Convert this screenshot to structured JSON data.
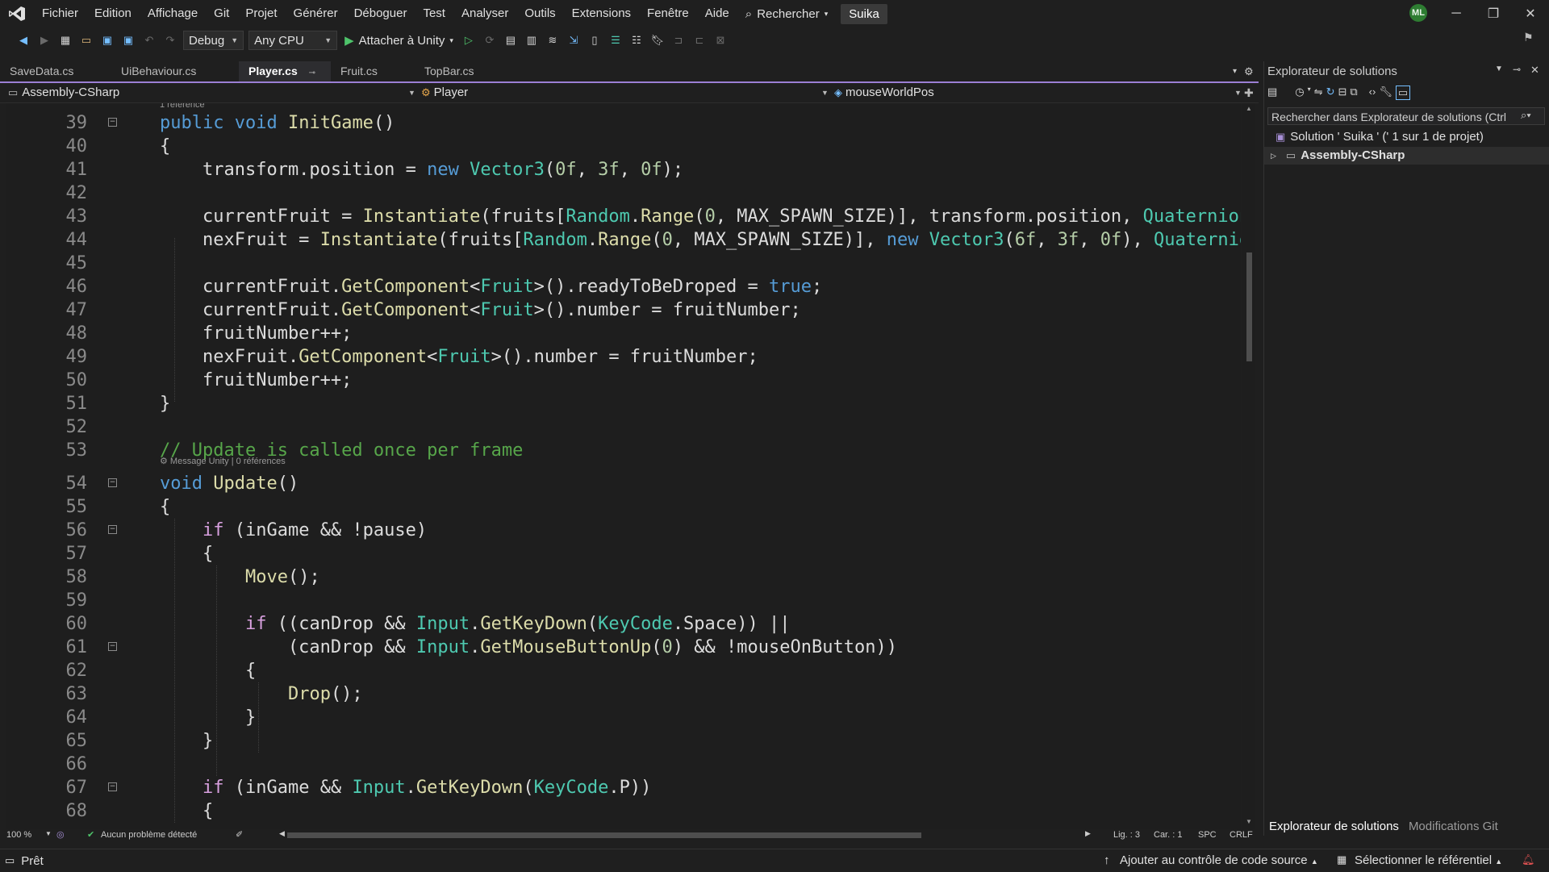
{
  "menu": [
    "Fichier",
    "Edition",
    "Affichage",
    "Git",
    "Projet",
    "Générer",
    "Déboguer",
    "Test",
    "Analyser",
    "Outils",
    "Extensions",
    "Fenêtre",
    "Aide"
  ],
  "search_label": "Rechercher",
  "solution_name": "Suika",
  "user_initials": "ML",
  "toolbar": {
    "config": "Debug",
    "platform": "Any CPU",
    "attach_label": "Attacher à Unity"
  },
  "tabs": [
    {
      "label": "SaveData.cs",
      "active": false
    },
    {
      "label": "UiBehaviour.cs",
      "active": false
    },
    {
      "label": "Player.cs",
      "active": true
    },
    {
      "label": "Fruit.cs",
      "active": false
    },
    {
      "label": "TopBar.cs",
      "active": false
    }
  ],
  "nav": {
    "project": "Assembly-CSharp",
    "type": "Player",
    "member": "mouseWorldPos"
  },
  "codelens": {
    "top": "1 référence",
    "update": "Message Unity | 0 références"
  },
  "code": [
    {
      "n": "39",
      "fold": true,
      "tokens": [
        [
          "kw",
          "public"
        ],
        [
          "pl",
          " "
        ],
        [
          "kw",
          "void"
        ],
        [
          "pl",
          " "
        ],
        [
          "fn",
          "InitGame"
        ],
        [
          "pl",
          "()"
        ]
      ]
    },
    {
      "n": "40",
      "tokens": [
        [
          "pl",
          "{"
        ]
      ]
    },
    {
      "n": "41",
      "tokens": [
        [
          "pl",
          "    transform.position = "
        ],
        [
          "kw",
          "new"
        ],
        [
          "pl",
          " "
        ],
        [
          "ty",
          "Vector3"
        ],
        [
          "pl",
          "("
        ],
        [
          "num",
          "0f"
        ],
        [
          "pl",
          ", "
        ],
        [
          "num",
          "3f"
        ],
        [
          "pl",
          ", "
        ],
        [
          "num",
          "0f"
        ],
        [
          "pl",
          ");"
        ]
      ]
    },
    {
      "n": "42",
      "tokens": []
    },
    {
      "n": "43",
      "tokens": [
        [
          "pl",
          "    currentFruit = "
        ],
        [
          "fn",
          "Instantiate"
        ],
        [
          "pl",
          "(fruits["
        ],
        [
          "ty",
          "Random"
        ],
        [
          "pl",
          "."
        ],
        [
          "fn",
          "Range"
        ],
        [
          "pl",
          "("
        ],
        [
          "num",
          "0"
        ],
        [
          "pl",
          ", MAX_SPAWN_SIZE)], transform.position, "
        ],
        [
          "ty",
          "Quaternion"
        ],
        [
          "pl",
          ".i"
        ]
      ]
    },
    {
      "n": "44",
      "tokens": [
        [
          "pl",
          "    nexFruit = "
        ],
        [
          "fn",
          "Instantiate"
        ],
        [
          "pl",
          "(fruits["
        ],
        [
          "ty",
          "Random"
        ],
        [
          "pl",
          "."
        ],
        [
          "fn",
          "Range"
        ],
        [
          "pl",
          "("
        ],
        [
          "num",
          "0"
        ],
        [
          "pl",
          ", MAX_SPAWN_SIZE)], "
        ],
        [
          "kw",
          "new"
        ],
        [
          "pl",
          " "
        ],
        [
          "ty",
          "Vector3"
        ],
        [
          "pl",
          "("
        ],
        [
          "num",
          "6f"
        ],
        [
          "pl",
          ", "
        ],
        [
          "num",
          "3f"
        ],
        [
          "pl",
          ", "
        ],
        [
          "num",
          "0f"
        ],
        [
          "pl",
          "), "
        ],
        [
          "ty",
          "Quaternion"
        ]
      ]
    },
    {
      "n": "45",
      "tokens": []
    },
    {
      "n": "46",
      "tokens": [
        [
          "pl",
          "    currentFruit."
        ],
        [
          "fn",
          "GetComponent"
        ],
        [
          "pl",
          "<"
        ],
        [
          "ty",
          "Fruit"
        ],
        [
          "pl",
          ">().readyToBeDroped = "
        ],
        [
          "kw",
          "true"
        ],
        [
          "pl",
          ";"
        ]
      ]
    },
    {
      "n": "47",
      "tokens": [
        [
          "pl",
          "    currentFruit."
        ],
        [
          "fn",
          "GetComponent"
        ],
        [
          "pl",
          "<"
        ],
        [
          "ty",
          "Fruit"
        ],
        [
          "pl",
          ">().number = fruitNumber;"
        ]
      ]
    },
    {
      "n": "48",
      "tokens": [
        [
          "pl",
          "    fruitNumber++;"
        ]
      ]
    },
    {
      "n": "49",
      "tokens": [
        [
          "pl",
          "    nexFruit."
        ],
        [
          "fn",
          "GetComponent"
        ],
        [
          "pl",
          "<"
        ],
        [
          "ty",
          "Fruit"
        ],
        [
          "pl",
          ">().number = fruitNumber;"
        ]
      ]
    },
    {
      "n": "50",
      "tokens": [
        [
          "pl",
          "    fruitNumber++;"
        ]
      ]
    },
    {
      "n": "51",
      "tokens": [
        [
          "pl",
          "}"
        ]
      ]
    },
    {
      "n": "52",
      "tokens": []
    },
    {
      "n": "53",
      "tokens": [
        [
          "cmt",
          "// Update is called once per frame"
        ]
      ]
    },
    {
      "n": "54",
      "fold": true,
      "tokens": [
        [
          "kw",
          "void"
        ],
        [
          "pl",
          " "
        ],
        [
          "fn",
          "Update"
        ],
        [
          "pl",
          "()"
        ]
      ]
    },
    {
      "n": "55",
      "tokens": [
        [
          "pl",
          "{"
        ]
      ]
    },
    {
      "n": "56",
      "fold": true,
      "tokens": [
        [
          "pl",
          "    "
        ],
        [
          "ctl",
          "if"
        ],
        [
          "pl",
          " (inGame && !pause)"
        ]
      ]
    },
    {
      "n": "57",
      "tokens": [
        [
          "pl",
          "    {"
        ]
      ]
    },
    {
      "n": "58",
      "tokens": [
        [
          "pl",
          "        "
        ],
        [
          "fn",
          "Move"
        ],
        [
          "pl",
          "();"
        ]
      ]
    },
    {
      "n": "59",
      "tokens": []
    },
    {
      "n": "60",
      "tokens": [
        [
          "pl",
          "        "
        ],
        [
          "ctl",
          "if"
        ],
        [
          "pl",
          " ((canDrop && "
        ],
        [
          "ty",
          "Input"
        ],
        [
          "pl",
          "."
        ],
        [
          "fn",
          "GetKeyDown"
        ],
        [
          "pl",
          "("
        ],
        [
          "ty",
          "KeyCode"
        ],
        [
          "pl",
          ".Space)) ||"
        ]
      ]
    },
    {
      "n": "61",
      "fold": true,
      "tokens": [
        [
          "pl",
          "            (canDrop && "
        ],
        [
          "ty",
          "Input"
        ],
        [
          "pl",
          "."
        ],
        [
          "fn",
          "GetMouseButtonUp"
        ],
        [
          "pl",
          "("
        ],
        [
          "num",
          "0"
        ],
        [
          "pl",
          ") && !mouseOnButton))"
        ]
      ]
    },
    {
      "n": "62",
      "tokens": [
        [
          "pl",
          "        {"
        ]
      ]
    },
    {
      "n": "63",
      "tokens": [
        [
          "pl",
          "            "
        ],
        [
          "fn",
          "Drop"
        ],
        [
          "pl",
          "();"
        ]
      ]
    },
    {
      "n": "64",
      "tokens": [
        [
          "pl",
          "        }"
        ]
      ]
    },
    {
      "n": "65",
      "tokens": [
        [
          "pl",
          "    }"
        ]
      ]
    },
    {
      "n": "66",
      "tokens": []
    },
    {
      "n": "67",
      "fold": true,
      "tokens": [
        [
          "pl",
          "    "
        ],
        [
          "ctl",
          "if"
        ],
        [
          "pl",
          " (inGame && "
        ],
        [
          "ty",
          "Input"
        ],
        [
          "pl",
          "."
        ],
        [
          "fn",
          "GetKeyDown"
        ],
        [
          "pl",
          "("
        ],
        [
          "ty",
          "KeyCode"
        ],
        [
          "pl",
          ".P))"
        ]
      ]
    },
    {
      "n": "68",
      "tokens": [
        [
          "pl",
          "    {"
        ]
      ]
    }
  ],
  "editor_status": {
    "zoom": "100 %",
    "issues": "Aucun problème détecté",
    "line": "Lig. : 3",
    "col": "Car. : 1",
    "spc": "SPC",
    "eol": "CRLF"
  },
  "solution_explorer": {
    "title": "Explorateur de solutions",
    "search_placeholder": "Rechercher dans Explorateur de solutions (Ctrl",
    "solution_row": "Solution ' Suika ' (' 1 sur 1 de projet)",
    "project_row": "Assembly-CSharp",
    "tab_explorer": "Explorateur de solutions",
    "tab_git": "Modifications Git"
  },
  "statusbar": {
    "ready": "Prêt",
    "source_control": "Ajouter au contrôle de code source",
    "repo": "Sélectionner le référentiel"
  },
  "colors": {
    "accent": "#9b7fd4",
    "keyword": "#569cd6",
    "type": "#4ec9b0",
    "method": "#dcdcaa",
    "number": "#b5cea8",
    "comment": "#57a64a",
    "control": "#d8a0df"
  }
}
